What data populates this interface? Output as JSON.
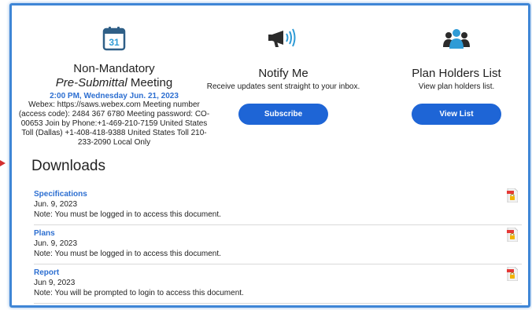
{
  "meeting": {
    "title": "Non-Mandatory",
    "subtitle_italic": "Pre-Submittal",
    "subtitle_rest": " Meeting",
    "time": "2:00 PM, Wednesday Jun. 21, 2023",
    "details": "Webex: https://saws.webex.com Meeting number (access code): 2484 367 6780 Meeting password: CO-00653 Join by Phone:+1-469-210-7159 United States Toll (Dallas) +1-408-418-9388 United States Toll 210-233-2090 Local Only",
    "icon": "calendar-icon",
    "calendar_day": "31"
  },
  "notify": {
    "title": "Notify Me",
    "subtitle": "Receive updates sent straight to your inbox.",
    "button": "Subscribe",
    "icon": "megaphone-icon"
  },
  "planholders": {
    "title": "Plan Holders List",
    "subtitle": "View plan holders list.",
    "button": "View List",
    "icon": "users-icon"
  },
  "downloads": {
    "heading": "Downloads",
    "items": [
      {
        "name": "Specifications",
        "date": "Jun. 9, 2023",
        "note": "Note: You must be logged in to access this document."
      },
      {
        "name": "Plans",
        "date": "Jun. 9, 2023",
        "note": "Note: You must be logged in to access this document."
      },
      {
        "name": "Report",
        "date": "Jun 9, 2023",
        "note": "Note: You will be prompted to login to access this document."
      }
    ]
  },
  "colors": {
    "accent": "#1e65d6",
    "link": "#2d6fd1",
    "frame": "#3f86d6",
    "pdf_red": "#e53935"
  }
}
